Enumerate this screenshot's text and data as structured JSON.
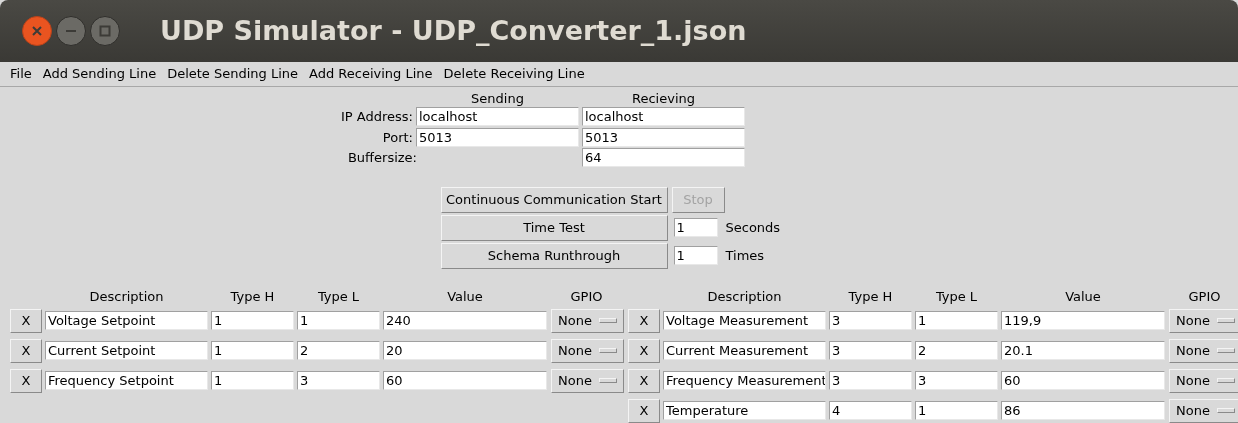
{
  "window": {
    "title": "UDP Simulator - UDP_Converter_1.json"
  },
  "menu": [
    "File",
    "Add Sending Line",
    "Delete Sending Line",
    "Add Receiving Line",
    "Delete Receiving Line"
  ],
  "connection": {
    "headers": [
      "Sending",
      "Recieving"
    ],
    "rows": [
      {
        "label": "IP Address:",
        "sending": "localhost",
        "receiving": "localhost"
      },
      {
        "label": "Port:",
        "sending": "5013",
        "receiving": "5013"
      },
      {
        "label": "Buffersize:",
        "receiving": "64"
      }
    ]
  },
  "controls": {
    "start_button": {
      "label": "Continuous Communication Start",
      "disabled": false
    },
    "stop_button": {
      "label": "Stop",
      "disabled": true
    },
    "time_test": {
      "label": "Time Test",
      "value": "1",
      "unit": "Seconds"
    },
    "schema_runthrough": {
      "label": "Schema Runthrough",
      "value": "1",
      "unit": "Times"
    }
  },
  "sending_table": {
    "columns": [
      "Description",
      "Type H",
      "Type L",
      "Value",
      "GPIO"
    ],
    "rows": [
      {
        "delete": "X",
        "description": "Voltage Setpoint",
        "type_h": "1",
        "type_l": "1",
        "value": "240",
        "gpio": "None"
      },
      {
        "delete": "X",
        "description": "Current Setpoint",
        "type_h": "1",
        "type_l": "2",
        "value": "20",
        "gpio": "None"
      },
      {
        "delete": "X",
        "description": "Frequency Setpoint",
        "type_h": "1",
        "type_l": "3",
        "value": "60",
        "gpio": "None"
      }
    ]
  },
  "receiving_table": {
    "columns": [
      "Description",
      "Type H",
      "Type L",
      "Value",
      "GPIO"
    ],
    "rows": [
      {
        "delete": "X",
        "description": "Voltage Measurement",
        "type_h": "3",
        "type_l": "1",
        "value": "119,9",
        "gpio": "None"
      },
      {
        "delete": "X",
        "description": "Current Measurement",
        "type_h": "3",
        "type_l": "2",
        "value": "20.1",
        "gpio": "None"
      },
      {
        "delete": "X",
        "description": "Frequency Measurement",
        "type_h": "3",
        "type_l": "3",
        "value": "60",
        "gpio": "None"
      },
      {
        "delete": "X",
        "description": "Temperature",
        "type_h": "4",
        "type_l": "1",
        "value": "86",
        "gpio": "None"
      }
    ]
  }
}
